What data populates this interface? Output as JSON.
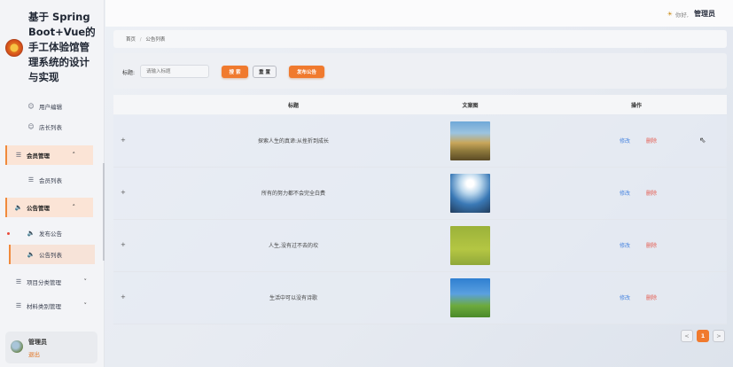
{
  "app": {
    "title": "基于 Spring Boot+Vue的手工体验馆管理系统的设计与实现"
  },
  "sidebar": {
    "items": [
      {
        "label": "用户编辑",
        "icon": "user-icon"
      },
      {
        "label": "店长列表",
        "icon": "user-icon"
      },
      {
        "label": "会员管理",
        "icon": "list-icon",
        "chevron": "^"
      },
      {
        "label": "会员列表",
        "icon": "list-icon"
      },
      {
        "label": "公告管理",
        "icon": "speaker-icon",
        "chevron": "^"
      },
      {
        "label": "发布公告",
        "icon": "speaker-icon"
      },
      {
        "label": "公告列表",
        "icon": "speaker-icon"
      },
      {
        "label": "项目分类管理",
        "icon": "list-icon",
        "chevron": "v"
      },
      {
        "label": "材料类别管理",
        "icon": "list-icon",
        "chevron": "v"
      }
    ],
    "user": {
      "name": "管理员",
      "logout": "退出"
    }
  },
  "header": {
    "greeting": "你好,",
    "username": "管理员"
  },
  "breadcrumb": {
    "home": "首页",
    "separator": "/",
    "current": "公告列表"
  },
  "toolbar": {
    "title_label": "标题:",
    "search_placeholder": "请输入标题",
    "search_button": "搜 索",
    "reset_button": "重 置",
    "publish_button": "发布公告"
  },
  "table": {
    "headers": [
      "标题",
      "文案图",
      "操作"
    ],
    "rows": [
      {
        "title": "探索人生的真谛:从挫折到成长",
        "edit": "修改",
        "delete": "删除"
      },
      {
        "title": "所有的努力都不会完全白费",
        "edit": "修改",
        "delete": "删除"
      },
      {
        "title": "人生,没有过不去的坎",
        "edit": "修改",
        "delete": "删除"
      },
      {
        "title": "生活中可以没有诗歌",
        "edit": "修改",
        "delete": "删除"
      }
    ]
  },
  "pagination": {
    "prev": "<",
    "current": "1",
    "next": ">"
  },
  "colors": {
    "accent": "#f07a2e",
    "link": "#4a86e0",
    "danger": "#e55a4e"
  }
}
